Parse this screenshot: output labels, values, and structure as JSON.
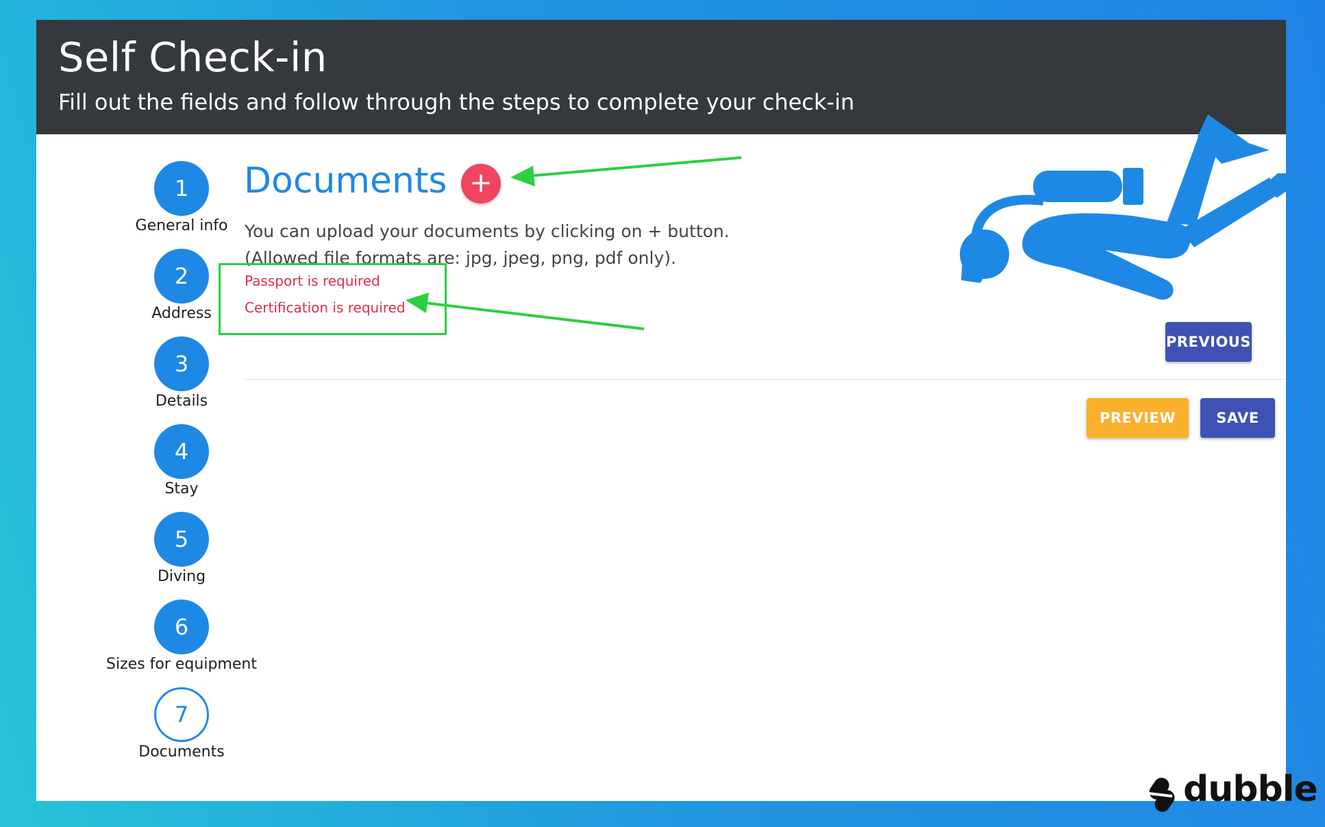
{
  "header": {
    "title": "Self Check-in",
    "subtitle": "Fill out the fields and follow through the steps to complete your check-in"
  },
  "steps": [
    {
      "number": "1",
      "label": "General info"
    },
    {
      "number": "2",
      "label": "Address"
    },
    {
      "number": "3",
      "label": "Details"
    },
    {
      "number": "4",
      "label": "Stay"
    },
    {
      "number": "5",
      "label": "Diving"
    },
    {
      "number": "6",
      "label": "Sizes for equipment"
    },
    {
      "number": "7",
      "label": "Documents"
    }
  ],
  "current_step": 7,
  "documents": {
    "title": "Documents",
    "add_button": "+",
    "info_line1": "You can upload your documents by clicking on + button.",
    "info_line2": "(Allowed file formats are: jpg, jpeg, png, pdf only).",
    "errors": [
      "Passport is required",
      "Certification is required"
    ]
  },
  "buttons": {
    "previous": "PREVIOUS",
    "preview": "PREVIEW",
    "save": "SAVE"
  },
  "brand": "dubble",
  "colors": {
    "accent": "#1e88e5",
    "error": "#d9304a",
    "add_button": "#f0455f",
    "primary_button": "#3f51b5",
    "preview_button": "#fbb02c",
    "header_bg": "#35383c",
    "annotation": "#2ccf3f"
  },
  "icons": [
    "diver-icon",
    "plus-icon",
    "dubble-logo-icon"
  ]
}
